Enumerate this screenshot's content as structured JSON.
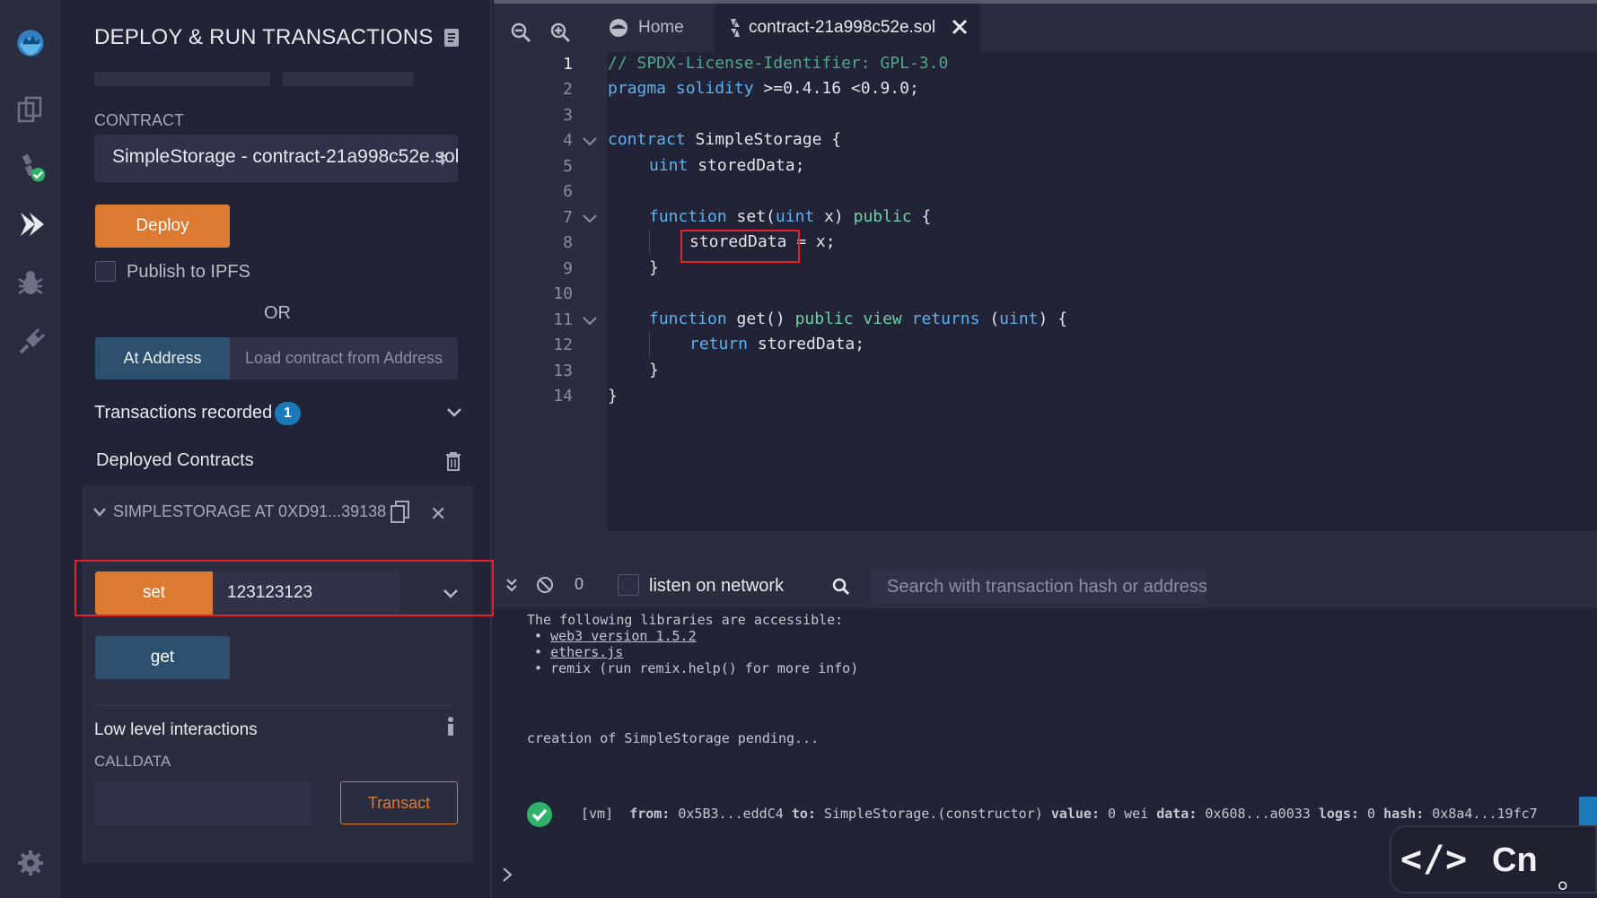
{
  "panel": {
    "title": "DEPLOY & RUN TRANSACTIONS",
    "contract_label": "CONTRACT",
    "contract_selected": "SimpleStorage - contract-21a998c52e.sol",
    "deploy_label": "Deploy",
    "ipfs_label": "Publish to IPFS",
    "or_label": "OR",
    "at_address_label": "At Address",
    "at_address_placeholder": "Load contract from Address",
    "tx_recorded_label": "Transactions recorded",
    "tx_recorded_count": "1",
    "deployed_label": "Deployed Contracts",
    "instance": {
      "title": "SIMPLESTORAGE AT 0XD91...39138",
      "set_label": "set",
      "set_value": "123123123",
      "get_label": "get",
      "lowlevel_label": "Low level interactions",
      "calldata_label": "CALLDATA",
      "transact_label": "Transact"
    }
  },
  "editor": {
    "home_tab": "Home",
    "file_tab": "contract-21a998c52e.sol",
    "line_numbers": [
      "1",
      "2",
      "3",
      "4",
      "5",
      "6",
      "7",
      "8",
      "9",
      "10",
      "11",
      "12",
      "13",
      "14"
    ],
    "code": {
      "l1": "// SPDX-License-Identifier: GPL-3.0",
      "l2_kw": "pragma solidity",
      "l2_rest": " >=0.4.16 <0.9.0;",
      "l4_kw": "contract",
      "l4_rest": " SimpleStorage {",
      "l5_kw": "uint",
      "l5_rest": " storedData;",
      "l7_kw": "function",
      "l7_a": " set(",
      "l7_type": "uint",
      "l7_b": " x) ",
      "l7_mod": "public",
      "l7_c": " {",
      "l8_a": "storedData",
      "l8_b": " = x;",
      "l9": "}",
      "l11_kw": "function",
      "l11_a": " get() ",
      "l11_mod": "public view",
      "l11_b": " ",
      "l11_ret": "returns",
      "l11_c": " (",
      "l11_type": "uint",
      "l11_d": ") {",
      "l12_kw": "return",
      "l12_rest": " storedData;",
      "l13": "}",
      "l14": "}"
    }
  },
  "terminal": {
    "count": "0",
    "listen_label": "listen on network",
    "search_placeholder": "Search with transaction hash or address",
    "libs_intro": "The following libraries are accessible:",
    "lib_web3": "web3 version 1.5.2",
    "lib_ethers": "ethers.js",
    "lib_remix": "remix (run remix.help() for more info)",
    "pending": "creation of SimpleStorage pending...",
    "tx_tag": "[vm]",
    "tx_from_key": "from:",
    "tx_from_val": "0x5B3...eddC4",
    "tx_to_key": "to:",
    "tx_to_val": "SimpleStorage.(constructor)",
    "tx_value_key": "value:",
    "tx_value_val": "0 wei",
    "tx_data_key": "data:",
    "tx_data_val": "0x608...a0033",
    "tx_logs_key": "logs:",
    "tx_logs_val": "0",
    "tx_hash_key": "hash:",
    "tx_hash_val": "0x8a4...19fc7"
  },
  "overlay": {
    "code_symbol": "</>",
    "lang": "Cn",
    "dot": "。"
  },
  "colors": {
    "accent_orange": "#dd7a32",
    "accent_blue": "#2d506f",
    "badge_blue": "#1b79b8",
    "highlight_red": "#e8202a",
    "success_green": "#2fb36b"
  }
}
